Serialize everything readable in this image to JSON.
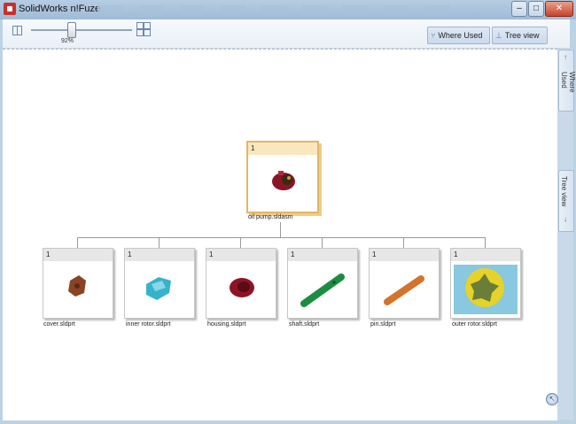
{
  "window": {
    "title": "SolidWorks n!Fuze"
  },
  "window_controls": {
    "minimize": "–",
    "maximize": "□",
    "close": "✕"
  },
  "toolbar": {
    "zoom_value": "92%",
    "zoom_fraction": 0.92,
    "where_used_label": "Where Used",
    "tree_view_label": "Tree view"
  },
  "side_tabs": {
    "where_used": "Where Used",
    "tree_view": "Tree view"
  },
  "tree": {
    "root": {
      "qty": "1",
      "name": "oil pump.sldasm"
    },
    "children": [
      {
        "qty": "1",
        "name": "cover.sldprt"
      },
      {
        "qty": "1",
        "name": "inner rotor.sldprt"
      },
      {
        "qty": "1",
        "name": "housing.sldprt"
      },
      {
        "qty": "1",
        "name": "shaft.sldprt"
      },
      {
        "qty": "1",
        "name": "pin.sldprt"
      },
      {
        "qty": "1",
        "name": "outer rotor.sldprt"
      }
    ]
  },
  "icons": {
    "app": "solidworks-logo-icon",
    "help": "back-arrow-icon"
  }
}
